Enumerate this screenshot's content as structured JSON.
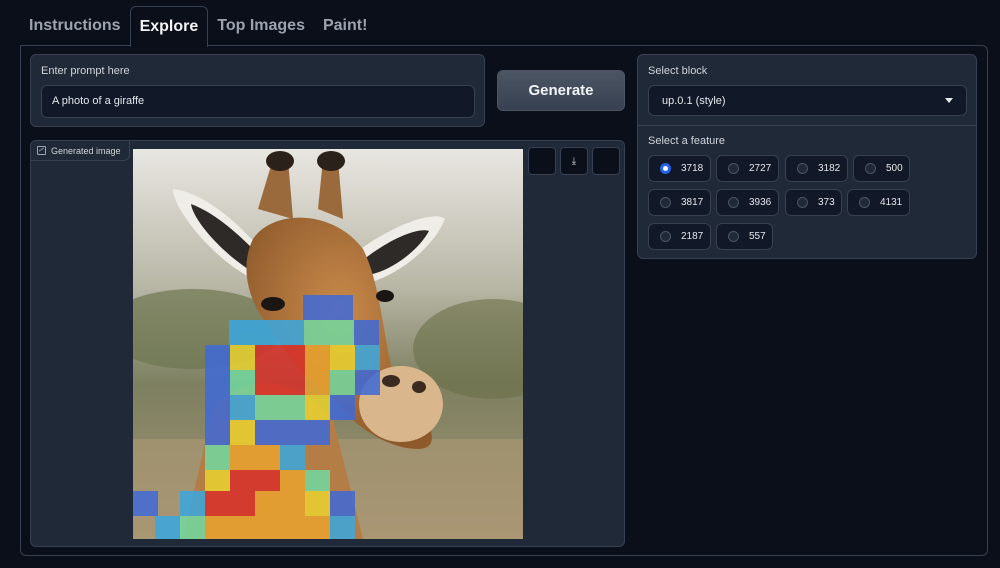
{
  "tabs": [
    "Instructions",
    "Explore",
    "Top Images",
    "Paint!"
  ],
  "active_tab": "Explore",
  "prompt": {
    "label": "Enter prompt here",
    "value": "A photo of a giraffe"
  },
  "generate_label": "Generate",
  "image_panel": {
    "label": "Generated image",
    "buttons": [
      "",
      "download-icon",
      ""
    ]
  },
  "block": {
    "label": "Select block",
    "value": "up.0.1 (style)"
  },
  "feature": {
    "label": "Select a feature",
    "options": [
      "3718",
      "2727",
      "3182",
      "500",
      "3817",
      "3936",
      "373",
      "4131",
      "2187",
      "557"
    ],
    "selected": "3718"
  },
  "colors": {
    "accent": "#2563eb",
    "panel": "#1f2937",
    "background": "#0b0f19"
  }
}
